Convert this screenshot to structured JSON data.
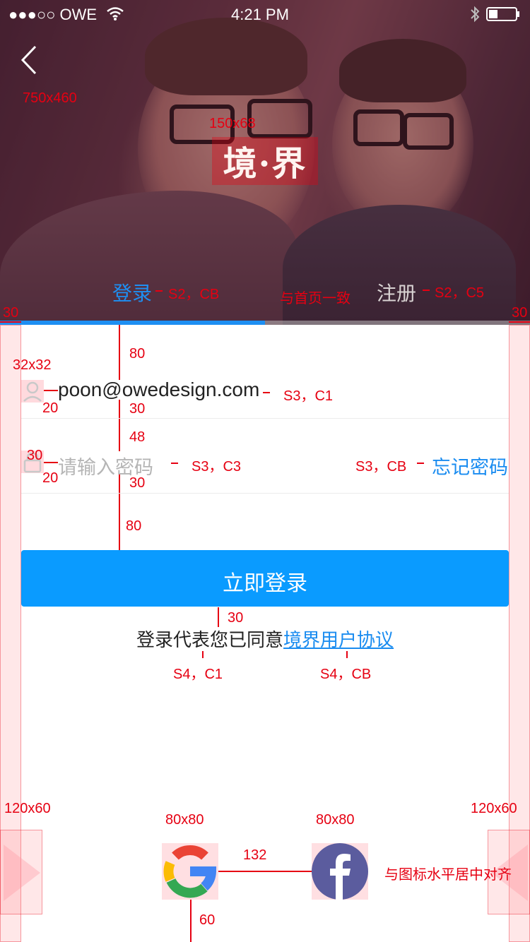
{
  "status_bar": {
    "carrier": "●●●○○ OWE",
    "time": "4:21 PM"
  },
  "hero": {
    "logo_text": "境·界",
    "size_label": "750x460",
    "logo_size_label": "150x68"
  },
  "tabs": {
    "login_label": "登录",
    "register_label": "注册",
    "login_spec": "S2，CB",
    "register_spec": "S2，C5",
    "consistent_note": "与首页一致"
  },
  "form": {
    "email_value": "poon@owedesign.com",
    "email_spec": "S3，C1",
    "password_placeholder": "请输入密码",
    "password_spec": "S3，C3",
    "forgot_spec": "S3，CB",
    "forgot_label": "忘记密码"
  },
  "login_button": {
    "label": "立即登录"
  },
  "agreement": {
    "prefix": "登录代表您已同意",
    "link": "境界用户协议",
    "prefix_spec": "S4，C1",
    "link_spec": "S4，CB"
  },
  "social": {
    "icon_size_label": "80x80",
    "gap_label": "132",
    "align_note": "与图标水平居中对齐",
    "bottom_label": "60",
    "side_size_label": "120x60"
  },
  "annotations": {
    "margin": "30",
    "icon32": "32x32",
    "d80": "80",
    "d30": "30",
    "d48": "48",
    "d20": "20",
    "d30b": "30"
  },
  "colors": {
    "accent": "#0A9BFF",
    "link": "#1A8CF0",
    "annotation": "#E60012",
    "facebook": "#5B5C9E"
  }
}
